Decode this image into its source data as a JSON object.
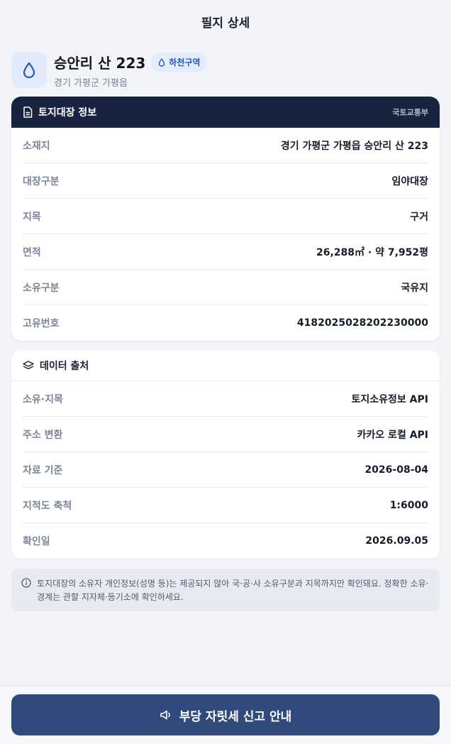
{
  "page": {
    "title": "필지 상세"
  },
  "header": {
    "icon": "water-drop-icon",
    "title": "승안리 산 223",
    "subtitle": "경기 가평군 가평읍",
    "badge": {
      "icon": "water-drop-icon",
      "label": "하천구역"
    }
  },
  "land_registry": {
    "title": "토지대장 정보",
    "icon": "document-icon",
    "source": "국토교통부",
    "rows": [
      {
        "label": "소재지",
        "value": "경기 가평군 가평읍 승안리 산 223"
      },
      {
        "label": "대장구분",
        "value": "임야대장"
      },
      {
        "label": "지목",
        "value": "구거"
      },
      {
        "label": "면적",
        "value": "26,288㎡ · 약 7,952평"
      },
      {
        "label": "소유구분",
        "value": "국유지"
      },
      {
        "label": "고유번호",
        "value": "4182025028202230000"
      }
    ]
  },
  "data_source": {
    "title": "데이터 출처",
    "icon": "layers-icon",
    "rows": [
      {
        "label": "소유·지목",
        "value": "토지소유정보 API"
      },
      {
        "label": "주소 변환",
        "value": "카카오 로컬 API"
      },
      {
        "label": "자료 기준",
        "value": "2026-08-04"
      },
      {
        "label": "지적도 축척",
        "value": "1:6000"
      },
      {
        "label": "확인일",
        "value": "2026.09.05"
      }
    ]
  },
  "notice": {
    "icon": "info-icon",
    "text": "토지대장의 소유자 개인정보(성명 등)는 제공되지 않아 국·공·사 소유구분과 지목까지만 확인돼요. 정확한 소유·경계는 관할 지자체·등기소에 확인하세요."
  },
  "footer": {
    "button_label": "부당 자릿세 신고 안내",
    "button_icon": "megaphone-icon"
  },
  "colors": {
    "accent": "#2f4a7b",
    "card_header": "#17233f",
    "badge_bg": "#e4edfb",
    "badge_text": "#2456b3"
  }
}
